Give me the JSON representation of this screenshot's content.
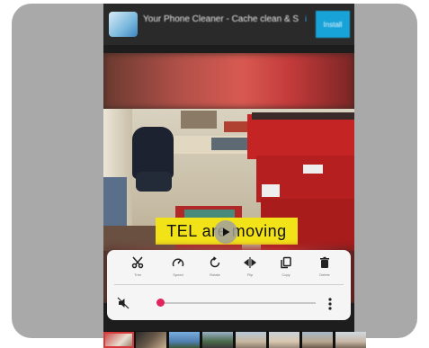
{
  "ad": {
    "title": "Your Phone Cleaner - Cache clean & S",
    "cta": "Install",
    "info": "i"
  },
  "video": {
    "caption": "TEL are moving"
  },
  "toolbar": {
    "tools": [
      {
        "icon": "scissors-icon",
        "label": "Trim"
      },
      {
        "icon": "speed-icon",
        "label": "Speed"
      },
      {
        "icon": "rotate-icon",
        "label": "Rotate"
      },
      {
        "icon": "flip-icon",
        "label": "Flip"
      },
      {
        "icon": "copy-icon",
        "label": "Copy"
      },
      {
        "icon": "delete-icon",
        "label": "Delete"
      }
    ]
  },
  "player": {
    "muted": true,
    "progress": 0.02
  },
  "colors": {
    "accent": "#e0245e",
    "caption_bg": "#f2e218",
    "ad_cta": "#17a3d8"
  }
}
